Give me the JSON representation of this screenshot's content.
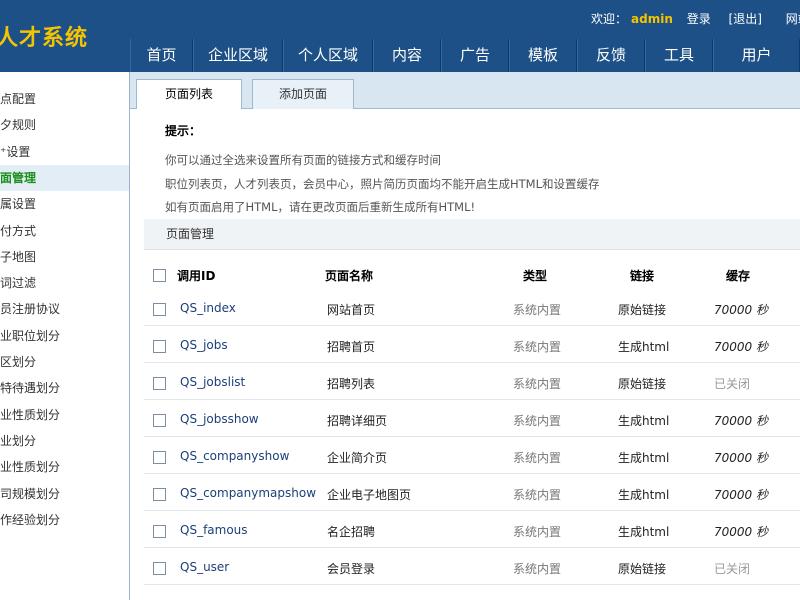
{
  "header": {
    "logo": "人才系统",
    "welcome": "欢迎：",
    "username": "admin",
    "login_link": "登录",
    "logout_link": "[退出]",
    "site_link": "网站"
  },
  "nav": [
    "首页",
    "企业区域",
    "个人区域",
    "内容",
    "广告",
    "模板",
    "反馈",
    "工具",
    "用户"
  ],
  "sidebar": {
    "items": [
      "点配置",
      "夕规则",
      "⁺设置",
      "面管理",
      "属设置",
      "付方式",
      "子地图",
      "词过滤",
      "员注册协议",
      "业职位划分",
      "区划分",
      "特待遇划分",
      "业性质划分",
      "业划分",
      "业性质划分",
      "司规模划分",
      "作经验划分"
    ],
    "active_index": 3
  },
  "tabs": [
    "页面列表",
    "添加页面"
  ],
  "tips": {
    "title": "提示：",
    "lines": [
      "你可以通过全选来设置所有页面的链接方式和缓存时间",
      "职位列表页，人才列表页，会员中心，照片简历页面均不能开启生成HTML和设置缓存",
      "如有页面启用了HTML，请在更改页面后重新生成所有HTML!"
    ]
  },
  "section": {
    "title": "页面管理"
  },
  "table": {
    "headers": [
      "调用ID",
      "页面名称",
      "类型",
      "链接",
      "缓存"
    ],
    "rows": [
      {
        "id": "QS_index",
        "name": "网站首页",
        "type": "系统内置",
        "link": "原始链接",
        "cache": "70000 秒"
      },
      {
        "id": "QS_jobs",
        "name": "招聘首页",
        "type": "系统内置",
        "link": "生成html",
        "cache": "70000 秒"
      },
      {
        "id": "QS_jobslist",
        "name": "招聘列表",
        "type": "系统内置",
        "link": "原始链接",
        "cache": "已关闭"
      },
      {
        "id": "QS_jobsshow",
        "name": "招聘详细页",
        "type": "系统内置",
        "link": "生成html",
        "cache": "70000 秒"
      },
      {
        "id": "QS_companyshow",
        "name": "企业简介页",
        "type": "系统内置",
        "link": "生成html",
        "cache": "70000 秒"
      },
      {
        "id": "QS_companymapshow",
        "name": "企业电子地图页",
        "type": "系统内置",
        "link": "生成html",
        "cache": "70000 秒"
      },
      {
        "id": "QS_famous",
        "name": "名企招聘",
        "type": "系统内置",
        "link": "生成html",
        "cache": "70000 秒"
      },
      {
        "id": "QS_user",
        "name": "会员登录",
        "type": "系统内置",
        "link": "原始链接",
        "cache": "已关闭"
      }
    ]
  }
}
